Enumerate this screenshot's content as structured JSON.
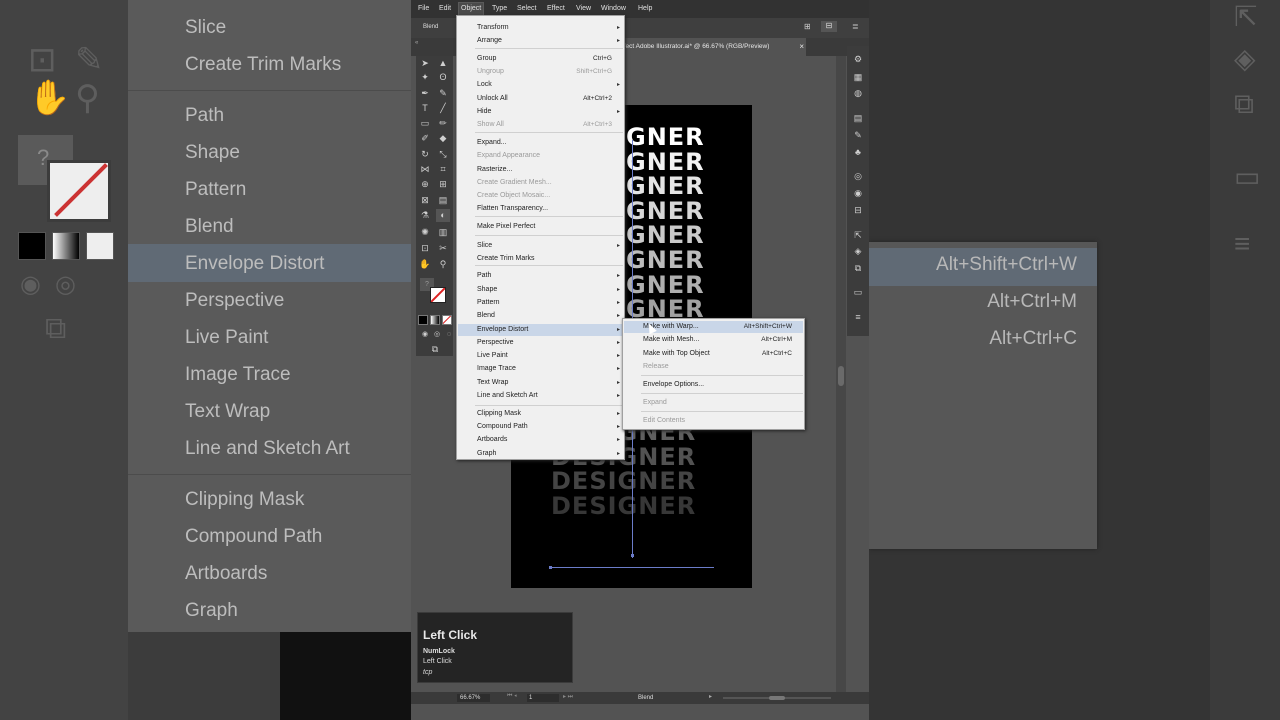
{
  "menubar": [
    "File",
    "Edit",
    "Object",
    "Type",
    "Select",
    "Effect",
    "View",
    "Window",
    "Help"
  ],
  "active_menu": "Object",
  "control_bar": {
    "label": "Blend"
  },
  "document_tab": {
    "title": "ffect Adobe Illustrator.ai* @ 66.67% (RGB/Preview)",
    "close": "×"
  },
  "artboard_word": "DESIGNER",
  "artboard_word_visible": "GNER",
  "object_menu": [
    {
      "label": "Transform",
      "submenu": true
    },
    {
      "label": "Arrange",
      "submenu": true
    },
    {
      "label": "Group",
      "shortcut": "Ctrl+G"
    },
    {
      "label": "Ungroup",
      "shortcut": "Shift+Ctrl+G",
      "disabled": true
    },
    {
      "label": "Lock",
      "submenu": true
    },
    {
      "label": "Unlock All",
      "shortcut": "Alt+Ctrl+2"
    },
    {
      "label": "Hide",
      "submenu": true
    },
    {
      "label": "Show All",
      "shortcut": "Alt+Ctrl+3",
      "disabled": true
    },
    {
      "label": "Expand..."
    },
    {
      "label": "Expand Appearance",
      "disabled": true
    },
    {
      "label": "Rasterize..."
    },
    {
      "label": "Create Gradient Mesh...",
      "disabled": true
    },
    {
      "label": "Create Object Mosaic...",
      "disabled": true
    },
    {
      "label": "Flatten Transparency..."
    },
    {
      "label": "Make Pixel Perfect"
    },
    {
      "label": "Slice",
      "submenu": true
    },
    {
      "label": "Create Trim Marks"
    },
    {
      "label": "Path",
      "submenu": true
    },
    {
      "label": "Shape",
      "submenu": true
    },
    {
      "label": "Pattern",
      "submenu": true
    },
    {
      "label": "Blend",
      "submenu": true
    },
    {
      "label": "Envelope Distort",
      "submenu": true,
      "highlighted": true
    },
    {
      "label": "Perspective",
      "submenu": true
    },
    {
      "label": "Live Paint",
      "submenu": true
    },
    {
      "label": "Image Trace",
      "submenu": true
    },
    {
      "label": "Text Wrap",
      "submenu": true
    },
    {
      "label": "Line and Sketch Art",
      "submenu": true
    },
    {
      "label": "Clipping Mask",
      "submenu": true
    },
    {
      "label": "Compound Path",
      "submenu": true
    },
    {
      "label": "Artboards",
      "submenu": true
    },
    {
      "label": "Graph",
      "submenu": true
    }
  ],
  "envelope_submenu": [
    {
      "label": "Make with Warp...",
      "shortcut": "Alt+Shift+Ctrl+W",
      "highlighted": true
    },
    {
      "label": "Make with Mesh...",
      "shortcut": "Alt+Ctrl+M"
    },
    {
      "label": "Make with Top Object",
      "shortcut": "Alt+Ctrl+C"
    },
    {
      "label": "Release",
      "disabled": true
    },
    {
      "label": "Envelope Options..."
    },
    {
      "label": "Expand",
      "disabled": true
    },
    {
      "label": "Edit Contents",
      "disabled": true
    }
  ],
  "tooltip": {
    "title": "Left Click",
    "line1": "NumLock",
    "line2": "Left Click",
    "line3": "tcp"
  },
  "statusbar": {
    "zoom": "66.67%",
    "page": "1",
    "status": "Blend"
  },
  "bg_left_items": [
    "Slice",
    "Create Trim Marks",
    "Path",
    "Shape",
    "Pattern",
    "Blend",
    "Envelope Distort",
    "Perspective",
    "Live Paint",
    "Image Trace",
    "Text Wrap",
    "Line and Sketch Art",
    "Clipping Mask",
    "Compound Path",
    "Artboards",
    "Graph"
  ],
  "bg_right_shortcuts": [
    "Alt+Shift+Ctrl+W",
    "Alt+Ctrl+M",
    "Alt+Ctrl+C"
  ],
  "bg_left_question": "?",
  "colors": {
    "menu_bg": "#f0f0f0",
    "menu_highlight": "#c9d6e8",
    "app_bg": "#535353",
    "artboard": "#000000"
  }
}
